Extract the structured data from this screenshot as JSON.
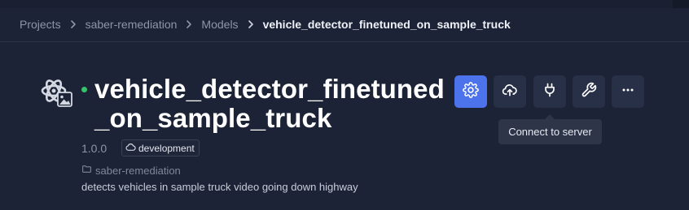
{
  "breadcrumb": {
    "items": [
      "Projects",
      "saber-remediation",
      "Models"
    ],
    "current": "vehicle_detector_finetuned_on_sample_truck"
  },
  "model": {
    "title": "vehicle_detector_finetuned_on_sample_truck",
    "status_color": "#35c26b",
    "version": "1.0.0",
    "tag": "development",
    "project": "saber-remediation",
    "description": "detects vehicles in sample truck video going down highway"
  },
  "actions": [
    {
      "icon": "gear-icon",
      "primary": true
    },
    {
      "icon": "cloud-upload-icon"
    },
    {
      "icon": "plug-icon"
    },
    {
      "icon": "wrench-icon"
    },
    {
      "icon": "more-horizontal-icon"
    }
  ],
  "tooltip": "Connect to server",
  "colors": {
    "background": "#1c2336",
    "button": "#283047",
    "accent": "#4c72ec"
  }
}
